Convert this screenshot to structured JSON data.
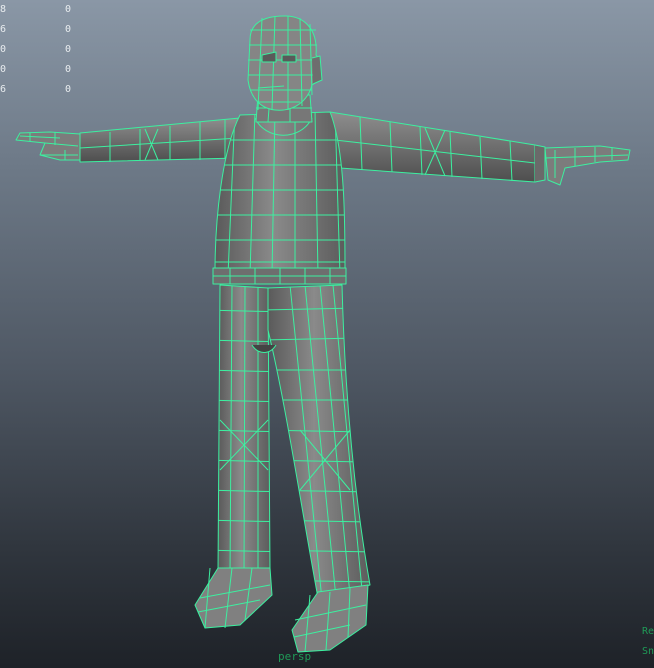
{
  "viewport": {
    "name": "3D perspective viewport",
    "camera_label": "persp",
    "heads_up_display": [
      {
        "col_a": "8",
        "col_b": "0"
      },
      {
        "col_a": "6",
        "col_b": "0"
      },
      {
        "col_a": "0",
        "col_b": "0"
      },
      {
        "col_a": "0",
        "col_b": "0"
      },
      {
        "col_a": "6",
        "col_b": "0"
      }
    ],
    "corner_labels": [
      "Re",
      "Sn"
    ]
  },
  "colors": {
    "wireframe": "#3cf0a0",
    "mesh_fill": "#7a7a7a",
    "background_top": "#8a97a6",
    "background_bottom": "#1e2228"
  }
}
